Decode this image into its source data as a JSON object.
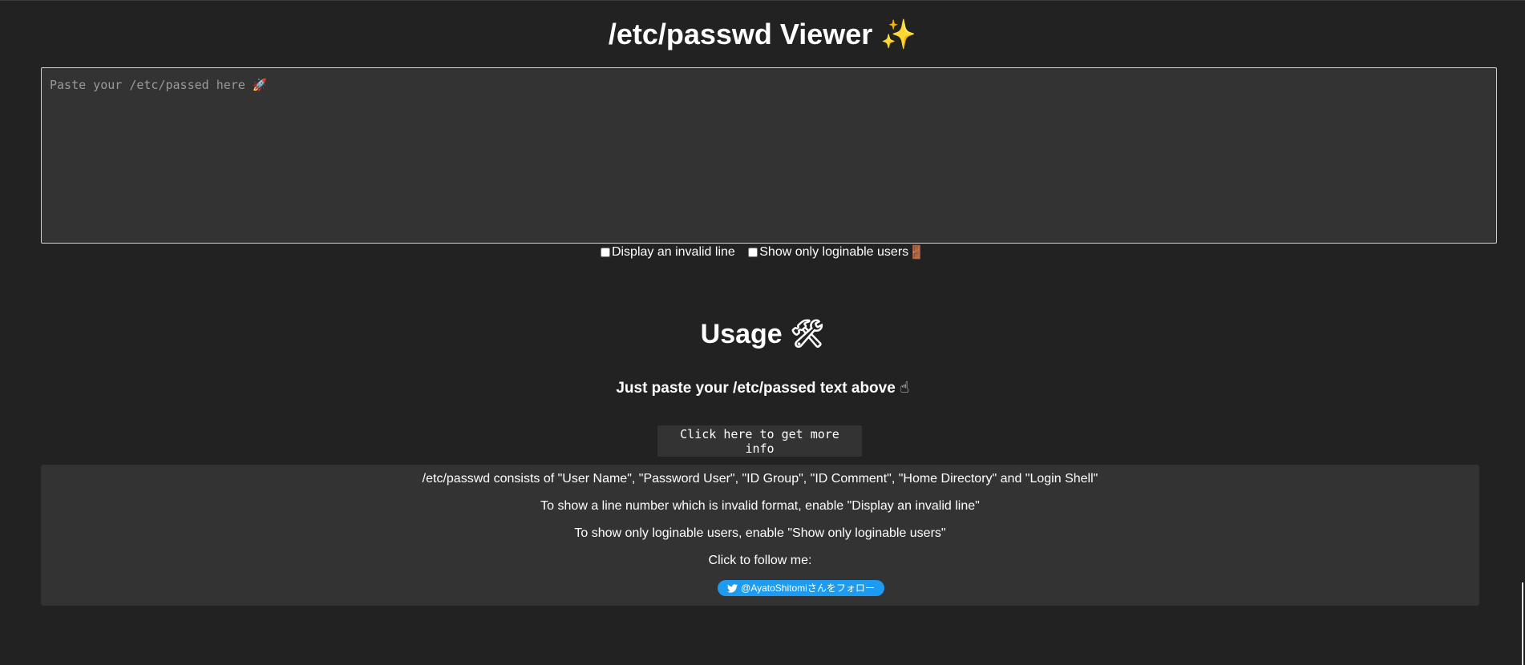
{
  "header": {
    "title": "/etc/passwd Viewer",
    "title_emoji": "✨"
  },
  "input": {
    "placeholder": "Paste your /etc/passed here 🚀",
    "value": ""
  },
  "options": {
    "invalid_line_label": "Display an invalid line",
    "invalid_line_checked": false,
    "loginable_label": "Show only loginable users",
    "loginable_emoji": "🚪",
    "loginable_checked": false
  },
  "usage": {
    "title": "Usage",
    "title_emoji": "🛠",
    "subtitle": "Just paste your /etc/passed text above",
    "subtitle_emoji": "☝",
    "more_info_button": "Click here to get more info"
  },
  "info": {
    "lines": [
      "/etc/passwd consists of \"User Name\", \"Password User\", \"ID Group\", \"ID Comment\", \"Home Directory\" and \"Login Shell\"",
      "To show a line number which is invalid format, enable \"Display an invalid line\"",
      "To show only loginable users, enable \"Show only loginable users\"",
      "Click to follow me:"
    ],
    "follow_button": "@AyatoShitomiさんをフォロー"
  },
  "colors": {
    "background": "#222222",
    "panel": "#333333",
    "twitter": "#1d9bf0"
  }
}
